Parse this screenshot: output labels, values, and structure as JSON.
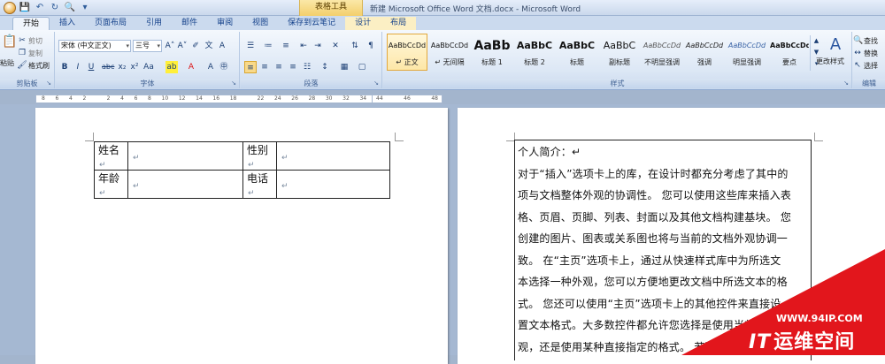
{
  "window": {
    "context_tools": "表格工具",
    "title": "新建 Microsoft Office Word 文档.docx - Microsoft Word"
  },
  "tabs": [
    {
      "label": "开始",
      "active": true
    },
    {
      "label": "插入"
    },
    {
      "label": "页面布局"
    },
    {
      "label": "引用"
    },
    {
      "label": "邮件"
    },
    {
      "label": "审阅"
    },
    {
      "label": "视图"
    },
    {
      "label": "保存到云笔记"
    },
    {
      "label": "设计",
      "context": true
    },
    {
      "label": "布局",
      "context": true
    }
  ],
  "clipboard": {
    "paste": "粘贴",
    "cut": "剪切",
    "copy": "复制",
    "format_painter": "格式刷",
    "label": "剪贴板"
  },
  "font": {
    "family": "宋体 (中文正文)",
    "size": "三号",
    "label": "字体"
  },
  "paragraph": {
    "label": "段落"
  },
  "styles": {
    "label": "样式",
    "items": [
      {
        "sample": "AaBbCcDd",
        "name": "↵ 正文",
        "active": true
      },
      {
        "sample": "AaBbCcDd",
        "name": "↵ 无间隔"
      },
      {
        "sample": "AaBb",
        "name": "标题 1"
      },
      {
        "sample": "AaBbC",
        "name": "标题 2"
      },
      {
        "sample": "AaBbC",
        "name": "标题"
      },
      {
        "sample": "AaBbC",
        "name": "副标题"
      },
      {
        "sample": "AaBbCcDd",
        "name": "不明显强调"
      },
      {
        "sample": "AaBbCcDd",
        "name": "强调"
      },
      {
        "sample": "AaBbCcDd",
        "name": "明显强调"
      },
      {
        "sample": "AaBbCcDd",
        "name": "要点"
      }
    ],
    "change_styles": "更改样式"
  },
  "editing": {
    "find": "查找",
    "replace": "替换",
    "select": "选择",
    "label": "编辑"
  },
  "ruler": {
    "ticks": [
      "8",
      "6",
      "4",
      "2",
      "",
      "2",
      "4",
      "6",
      "8",
      "10",
      "12",
      "14",
      "16",
      "18",
      "",
      "22",
      "24",
      "26",
      "28",
      "30",
      "32",
      "34",
      "36",
      "38"
    ],
    "ticks2": [
      "44",
      "46",
      "48"
    ]
  },
  "form_table": {
    "rows": [
      {
        "l1": "姓名",
        "l2": "性别"
      },
      {
        "l1": "年龄",
        "l2": "电话"
      }
    ],
    "mark": "↵"
  },
  "intro": {
    "lines": [
      "个人简介：↵",
      "对于“插入”选项卡上的库，在设计时都充分考虑了其中的",
      "项与文档整体外观的协调性。 您可以使用这些库来插入表",
      "格、页眉、页脚、列表、封面以及其他文档构建基块。 您",
      "创建的图片、图表或关系图也将与当前的文档外观协调一",
      "致。 在“主页”选项卡上，通过从快速样式库中为所选文",
      "本选择一种外观，您可以方便地更改文档中所选文本的格",
      "式。 您还可以使用“主页”选项卡上的其他控件来直接设",
      "置文本格式。大多数控件都允许您选择是使用当前主题外",
      "观，还是使用某种直接指定的格式。 若要"
    ]
  },
  "watermark": {
    "url": "WWW.94IP.COM",
    "brand_it": "IT",
    "brand_rest": "运维空间"
  },
  "colors": {
    "accent": "#15428b",
    "watermark_red": "#e2161c"
  }
}
